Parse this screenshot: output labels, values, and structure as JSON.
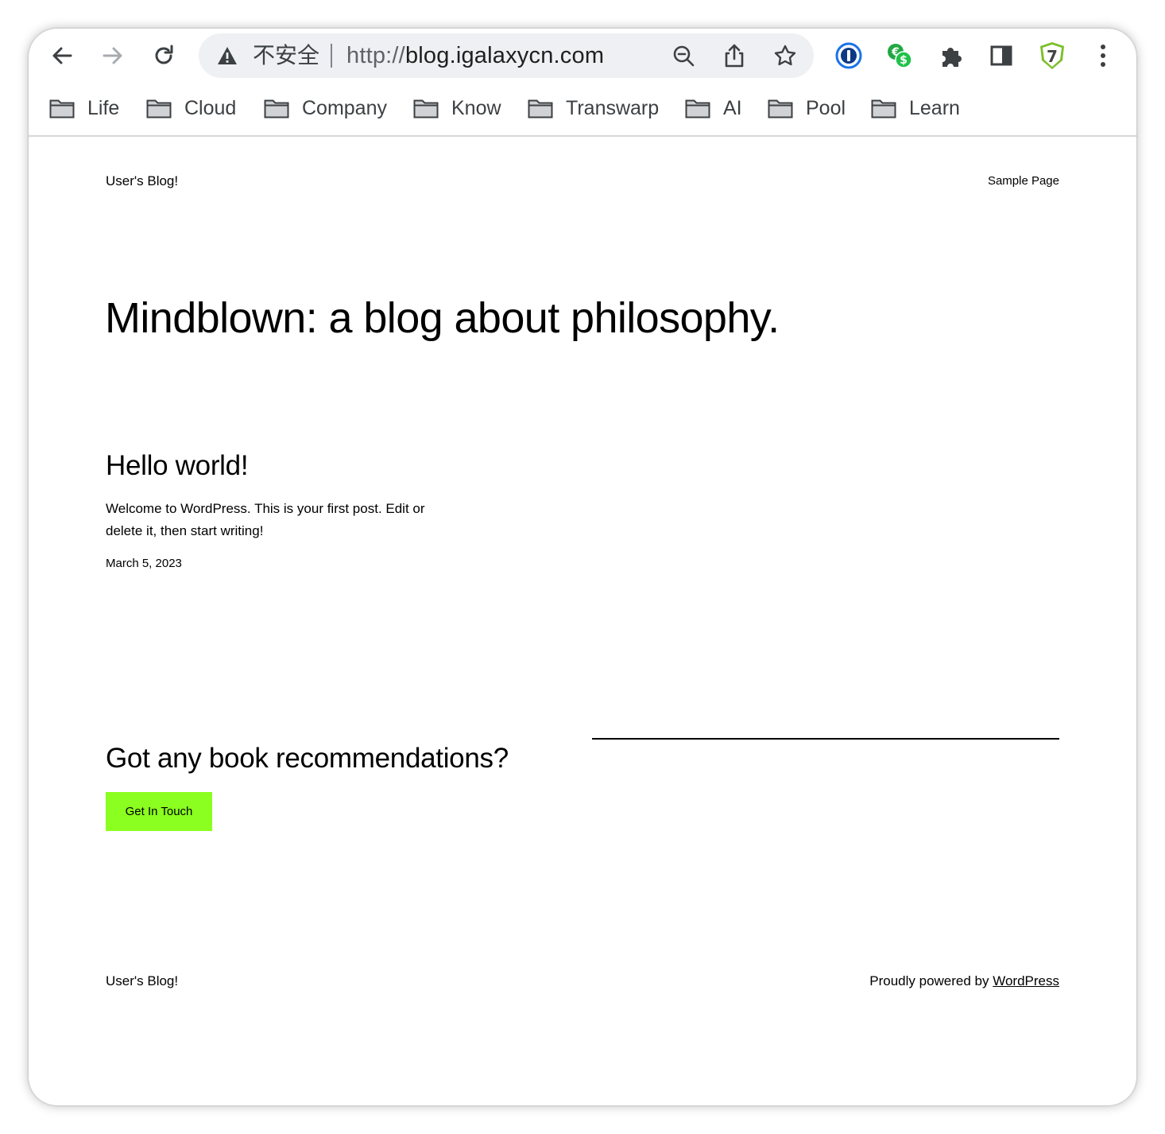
{
  "browser": {
    "security_label": "不安全",
    "url_scheme": "http://",
    "url_host": "blog.igalaxycn.com",
    "bookmarks": [
      "Life",
      "Cloud",
      "Company",
      "Know",
      "Transwarp",
      "AI",
      "Pool",
      "Learn"
    ],
    "icons": {
      "back": "arrow-left-icon",
      "forward": "arrow-right-icon",
      "reload": "reload-icon",
      "warning": "warning-triangle-icon",
      "zoom": "zoom-out-icon",
      "share": "share-icon",
      "bookmark": "star-icon",
      "ext1": "password-manager-icon",
      "ext2": "currency-converter-icon",
      "ext3": "puzzle-extensions-icon",
      "side_panel": "side-panel-icon",
      "ext4": "seven-shield-icon",
      "menu": "kebab-menu-icon"
    },
    "colors": {
      "omnibox_bg": "#eef0f3",
      "chrome_text": "#3c4043"
    }
  },
  "site": {
    "title": "User's Blog!",
    "nav": [
      "Sample Page"
    ],
    "hero": "Mindblown: a blog about philosophy.",
    "post": {
      "title": "Hello world!",
      "excerpt": "Welcome to WordPress. This is your first post. Edit or delete it, then start writing!",
      "date": "March 5, 2023"
    },
    "cta": {
      "heading": "Got any book recommendations?",
      "button": "Get In Touch",
      "button_color": "#8bff1f"
    },
    "footer": {
      "title": "User's Blog!",
      "powered_prefix": "Proudly powered by ",
      "powered_link": "WordPress"
    }
  }
}
